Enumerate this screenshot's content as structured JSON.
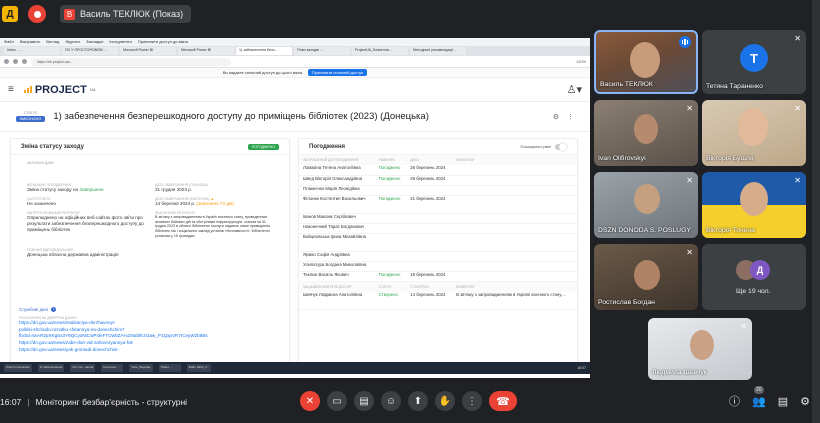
{
  "topbar": {
    "logo_letter": "Д",
    "presenter_badge": "В",
    "presenter_label": "Василь ТЕКЛЮК (Показ)"
  },
  "browser": {
    "menu": [
      "Файл",
      "Выправить",
      "Вигляд",
      "Журнал",
      "Закладки",
      "Інструменти",
      "Припинити доступ до вікна"
    ],
    "tabs": [
      "Inbox - ...",
      "ПС У ПРОСТОРОВОМ ...",
      "Microsoft Power BI",
      "Microsoft Power BI",
      "1) забезпечення безп...",
      "План заходів ...",
      "ProjectUA_Безпечна...",
      "Методичні рекомендації ..."
    ],
    "url": "https://hh.project.ua/...",
    "notice_text": "Ви надаєте спільний доступ до цього вікна",
    "notice_button": "Припинити спільний доступ",
    "zoom": "110%"
  },
  "app": {
    "brand": "PROJECT",
    "brand_sup": "UA",
    "status_label": "СТАТУС",
    "status_value": "ВИКОНАНО",
    "page_title": "1) забезпечення безперешкодного доступу до приміщень бібліотек (2023) (Донецька)",
    "left": {
      "title": "Зміна статусу заходу",
      "badge": "ПОГОДЖЕНО",
      "section": "ЗАГАЛЬНІ ДАНІ",
      "fields": [
        {
          "k": "ВІЗУАЛЬНЕ ПОГОДЖЕННЯ",
          "v": "Зміна статусу заходу на ",
          "hl": "Завершене"
        },
        {
          "k": "ДАТА ЗАВЕРШЕННЯ (ПЛАНОВА)",
          "v": "31 грудня 2023 р.",
          "hl": ""
        },
        {
          "k": "ЧАСТОТНІСТЬ",
          "v": "Не зазначено",
          "hl": ""
        },
        {
          "k": "ДАТА ЗАВЕРШЕННЯ (ФАКТИЧНА)",
          "v": "14 березня 2024 р.",
          "warn": "(запізнено 74 дні)"
        },
        {
          "k": "ЗАПРОПОНОВАНИЙ РЕЗУЛЬТАТ",
          "v": "Оприлюднено на офіційних веб-сайтах фото звіти про результати забезпечення безперешкодного доступу до приміщень бібліотек",
          "hl": ""
        },
        {
          "k": "ФАКТИЧНИЙ РЕЗУЛЬТАТ",
          "v": "В зв'язку з запровадженням в Україні воєнного стану, проведенням активних бойових дій та обстрілами інфраструктури, станом на 31 грудня 2023 в області бібліотечні послуги надають лише приміщення бібліотек так і соціальних заклад установ «Незламності». Бібліотечні установи у 15 громадах.",
          "hl": ""
        }
      ],
      "org_label": "ПОВНИЙ ВІДПОВІДАЛЬНИЙ",
      "org_value": "Донецька обласна державна адміністрація",
      "links_title": "Службові дані",
      "links_sub": "ПОСИЛАННЯ НА ДЖЕРЕЛА ДАНИХ",
      "links": [
        "https://dn.gov.ua/news/realizaciya-derzhavnoyi-",
        "politiki-shchodo-rozvitku-chitannya-na-donechchini?",
        "fbclid=IwAR2pXKgSx3Y9QCyxNtCwPxfeFTOw0ZA%20tabfKzI2aw_P1QxpVR7ICeyW2b8Bs",
        "https://dn.gov.ua/news/zabe-dan-vid-zahovoryannya-fok",
        "https://dn.gov.ua/news/yak-gromadi-donechchini-"
      ]
    },
    "right": {
      "title": "Погодження",
      "toggle_label": "Показувати рівні",
      "headers": [
        "ЗАПРОШЕНИЙ ДО ПОГОДЖЕННЯ",
        "РІШЕННЯ",
        "ДАТА",
        "КОМЕНТАР"
      ],
      "rows": [
        {
          "name": "Ломакіна Тетяна Анатоліївна",
          "status": "Погоджено",
          "date": "26 березень 2024",
          "comment": ""
        },
        {
          "name": "Швед Вікторія Олександрівна",
          "status": "Погоджено",
          "date": "25 березень 2024",
          "comment": ""
        },
        {
          "name": "Плакеєнко Марія Леонідівна",
          "status": "",
          "date": "",
          "comment": ""
        },
        {
          "name": "Філоник Костянтин Васильович",
          "status": "Погоджено",
          "date": "21 березень 2024",
          "comment": ""
        },
        {
          "name": "Іванов Максим Сергійович",
          "status": "",
          "date": "",
          "comment": ""
        },
        {
          "name": "Наконечний Тарас Богданович",
          "status": "",
          "date": "",
          "comment": ""
        },
        {
          "name": "Войцехівська Ірина Михайлівна",
          "status": "",
          "date": "",
          "comment": ""
        },
        {
          "name": "Ярмко Софія Андріївна",
          "status": "",
          "date": "",
          "comment": ""
        },
        {
          "name": "Хлипатура Богдана Миколаївна",
          "status": "",
          "date": "",
          "comment": ""
        },
        {
          "name": "Теклюк Василь Якович",
          "status": "Погоджено",
          "date": "18 березень 2024",
          "comment": ""
        }
      ],
      "headers2": [
        "ЗАЦІКАВЛЕНИЙ ПРОЦЕССОР",
        "СТАТУС",
        "СТВОРЕНО",
        "КОМЕНТАР"
      ],
      "rows2": [
        {
          "name": "Шевчук Людмила Анатоліївна",
          "status": "Створено",
          "date": "14 березень 2024",
          "comment": "В зв'язку з запровадженням в Україні воєнного стану,..."
        }
      ]
    }
  },
  "taskbar": {
    "items": [
      "Total Commander",
      "1) забезпечення",
      "Сіті тек - напов",
      "Інтеллект ...",
      "Теле_Бюд.Щь",
      "Плагн ...",
      "Файл 2023_2..."
    ],
    "sys": "16:07"
  },
  "bottom": {
    "time": "16:07",
    "separator": "|",
    "meeting_title": "Моніторинг безбар'єрність - структурні",
    "participants_count": "20"
  },
  "tiles": [
    {
      "name": "Василь ТЕКЛЮК",
      "speaking": true
    },
    {
      "name": "Тетяна Тараненко",
      "initial": "T",
      "color": "#1a73e8"
    },
    {
      "name": "Ivan Olifirovskyi"
    },
    {
      "name": "Вікторія Бушля"
    },
    {
      "name": "DSZN DONODA S. POSLUGY"
    },
    {
      "name": "Вікторія Точена"
    },
    {
      "name": "Ростислав Богдан"
    },
    {
      "name": "Людмила Шевчук"
    }
  ],
  "others": {
    "label": "Ще 19 чол.",
    "initial": "Д",
    "initial_color": "#7e57c2"
  }
}
